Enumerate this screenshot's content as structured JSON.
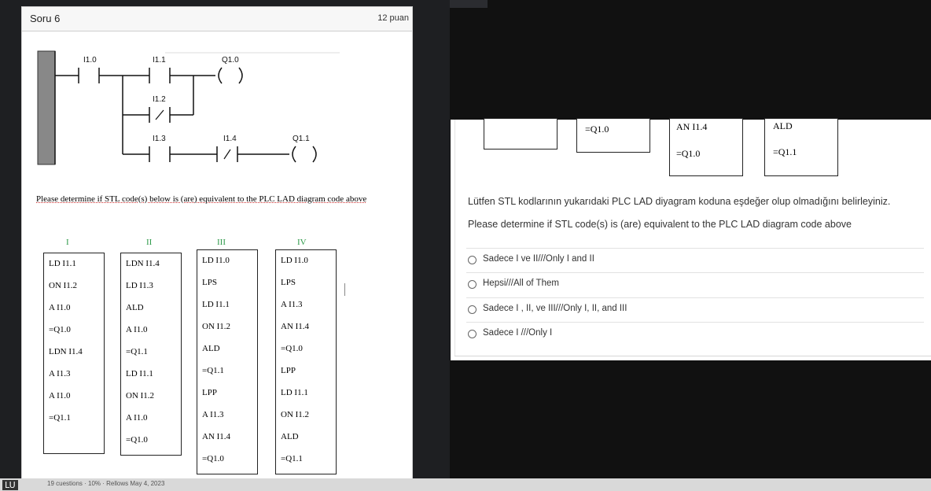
{
  "question": {
    "title": "Soru 6",
    "points": "12 puan"
  },
  "ladder": {
    "contacts": [
      "I1.0",
      "I1.1",
      "I1.2",
      "I1.3",
      "I1.4"
    ],
    "coils": [
      "Q1.0",
      "Q1.1"
    ]
  },
  "prompt_en": "Please determine if STL code(s) below is (are) equivalent to the PLC LAD diagram code above",
  "stl_columns": [
    {
      "label": "I",
      "lines": [
        "LD I1.1",
        "ON I1.2",
        "A I1.0",
        "=Q1.0",
        "LDN I1.4",
        "A I1.3",
        "A I1.0",
        "=Q1.1"
      ]
    },
    {
      "label": "II",
      "lines": [
        "LDN I1.4",
        "LD I1.3",
        "ALD",
        "A I1.0",
        "=Q1.1",
        "LD I1.1",
        "ON I1.2",
        "A I1.0",
        "=Q1.0"
      ]
    },
    {
      "label": "III",
      "lines": [
        "LD I1.0",
        "LPS",
        "LD I1.1",
        "ON I1.2",
        "ALD",
        "=Q1.1",
        "LPP",
        "A I1.3",
        "AN I1.4",
        "=Q1.0"
      ]
    },
    {
      "label": "IV",
      "lines": [
        "LD I1.0",
        "LPS",
        "A I1.3",
        "AN I1.4",
        "=Q1.0",
        "LPP",
        "LD I1.1",
        "ON I1.2",
        "ALD",
        "=Q1.1"
      ]
    }
  ],
  "right_boxes": {
    "b2": "=Q1.0",
    "b3_top": "AN I1.4",
    "b3_bottom": "=Q1.0",
    "b4_top": "ALD",
    "b4_bottom": "=Q1.1"
  },
  "right": {
    "prompt_tr": "Lütfen STL kodlarının yukarıdaki PLC LAD diyagram koduna eşdeğer olup olmadığını belirleyiniz.",
    "prompt_en": "Please determine if STL code(s) is (are) equivalent to the PLC LAD diagram code above",
    "options": [
      "Sadece I ve II///Only I and II",
      "Hepsi///All of Them",
      "Sadece I , II, ve III///Only I, II, and III",
      "Sadece I ///Only I"
    ]
  },
  "taskbar": {
    "lang": "LU",
    "status": "19 cuestions · 10% · Rellows May 4, 2023"
  }
}
